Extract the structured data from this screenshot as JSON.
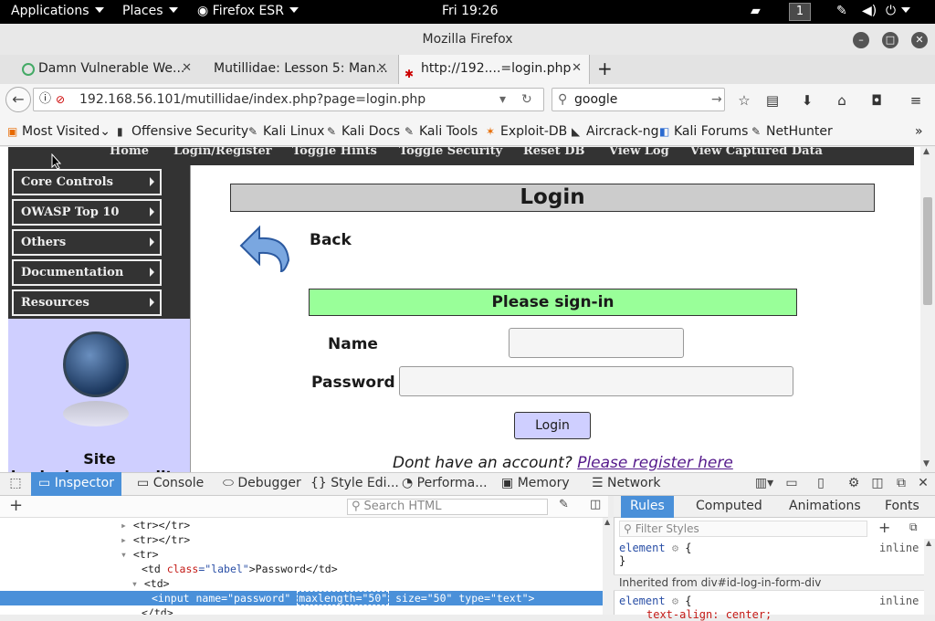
{
  "topbar": {
    "applications": "Applications",
    "places": "Places",
    "browser": "Firefox ESR",
    "clock": "Fri 19:26",
    "workspace": "1"
  },
  "window": {
    "title": "Mozilla Firefox"
  },
  "tabs": [
    {
      "label": "Damn Vulnerable We..."
    },
    {
      "label": "Mutillidae: Lesson 5: Man..."
    },
    {
      "label": "http://192....=login.php"
    }
  ],
  "nav": {
    "url": "192.168.56.101/mutillidae/index.php?page=login.php",
    "search": "google"
  },
  "bookmarks": [
    "Most Visited",
    "Offensive Security",
    "Kali Linux",
    "Kali Docs",
    "Kali Tools",
    "Exploit-DB",
    "Aircrack-ng",
    "Kali Forums",
    "NetHunter"
  ],
  "page": {
    "topnav": [
      "Home",
      "Login/Register",
      "Toggle Hints",
      "Toggle Security",
      "Reset DB",
      "View Log",
      "View Captured Data"
    ],
    "sidemenu": [
      "Core Controls",
      "OWASP Top 10",
      "Others",
      "Documentation",
      "Resources"
    ],
    "side_text": "Site hacked...err...quality-",
    "login_title": "Login",
    "back": "Back",
    "signin": "Please sign-in",
    "name_label": "Name",
    "password_label": "Password",
    "login_button": "Login",
    "no_account": "Dont have an account?",
    "register_link": "Please register here"
  },
  "devtools": {
    "tabs": [
      "Inspector",
      "Console",
      "Debugger",
      "Style Edi...",
      "Performa...",
      "Memory",
      "Network"
    ],
    "search_placeholder": "Search HTML",
    "rules_tabs": [
      "Rules",
      "Computed",
      "Animations",
      "Fonts"
    ],
    "filter_placeholder": "Filter Styles",
    "markup": {
      "l1": "<tr></tr>",
      "l2": "<tr></tr>",
      "l3": "<tr>",
      "l4a": "<td ",
      "l4b": "class",
      "l4c": "=\"label\"",
      "l4d": ">Password</td>",
      "l5": "<td>",
      "l6a": "<input ",
      "l6b": "name",
      "l6c": "=\"password\" ",
      "l6d": "maxlength=\"50\"",
      "l6e": " size",
      "l6f": "=\"50\" ",
      "l6g": "type",
      "l6h": "=\"text\">",
      "l7": "</td>"
    },
    "rules": {
      "element": "element",
      "brace_open": "{",
      "brace_close": "}",
      "inline": "inline",
      "inherited": "Inherited from div#id-log-in-form-div",
      "next_prop": "text-align: center;"
    }
  }
}
